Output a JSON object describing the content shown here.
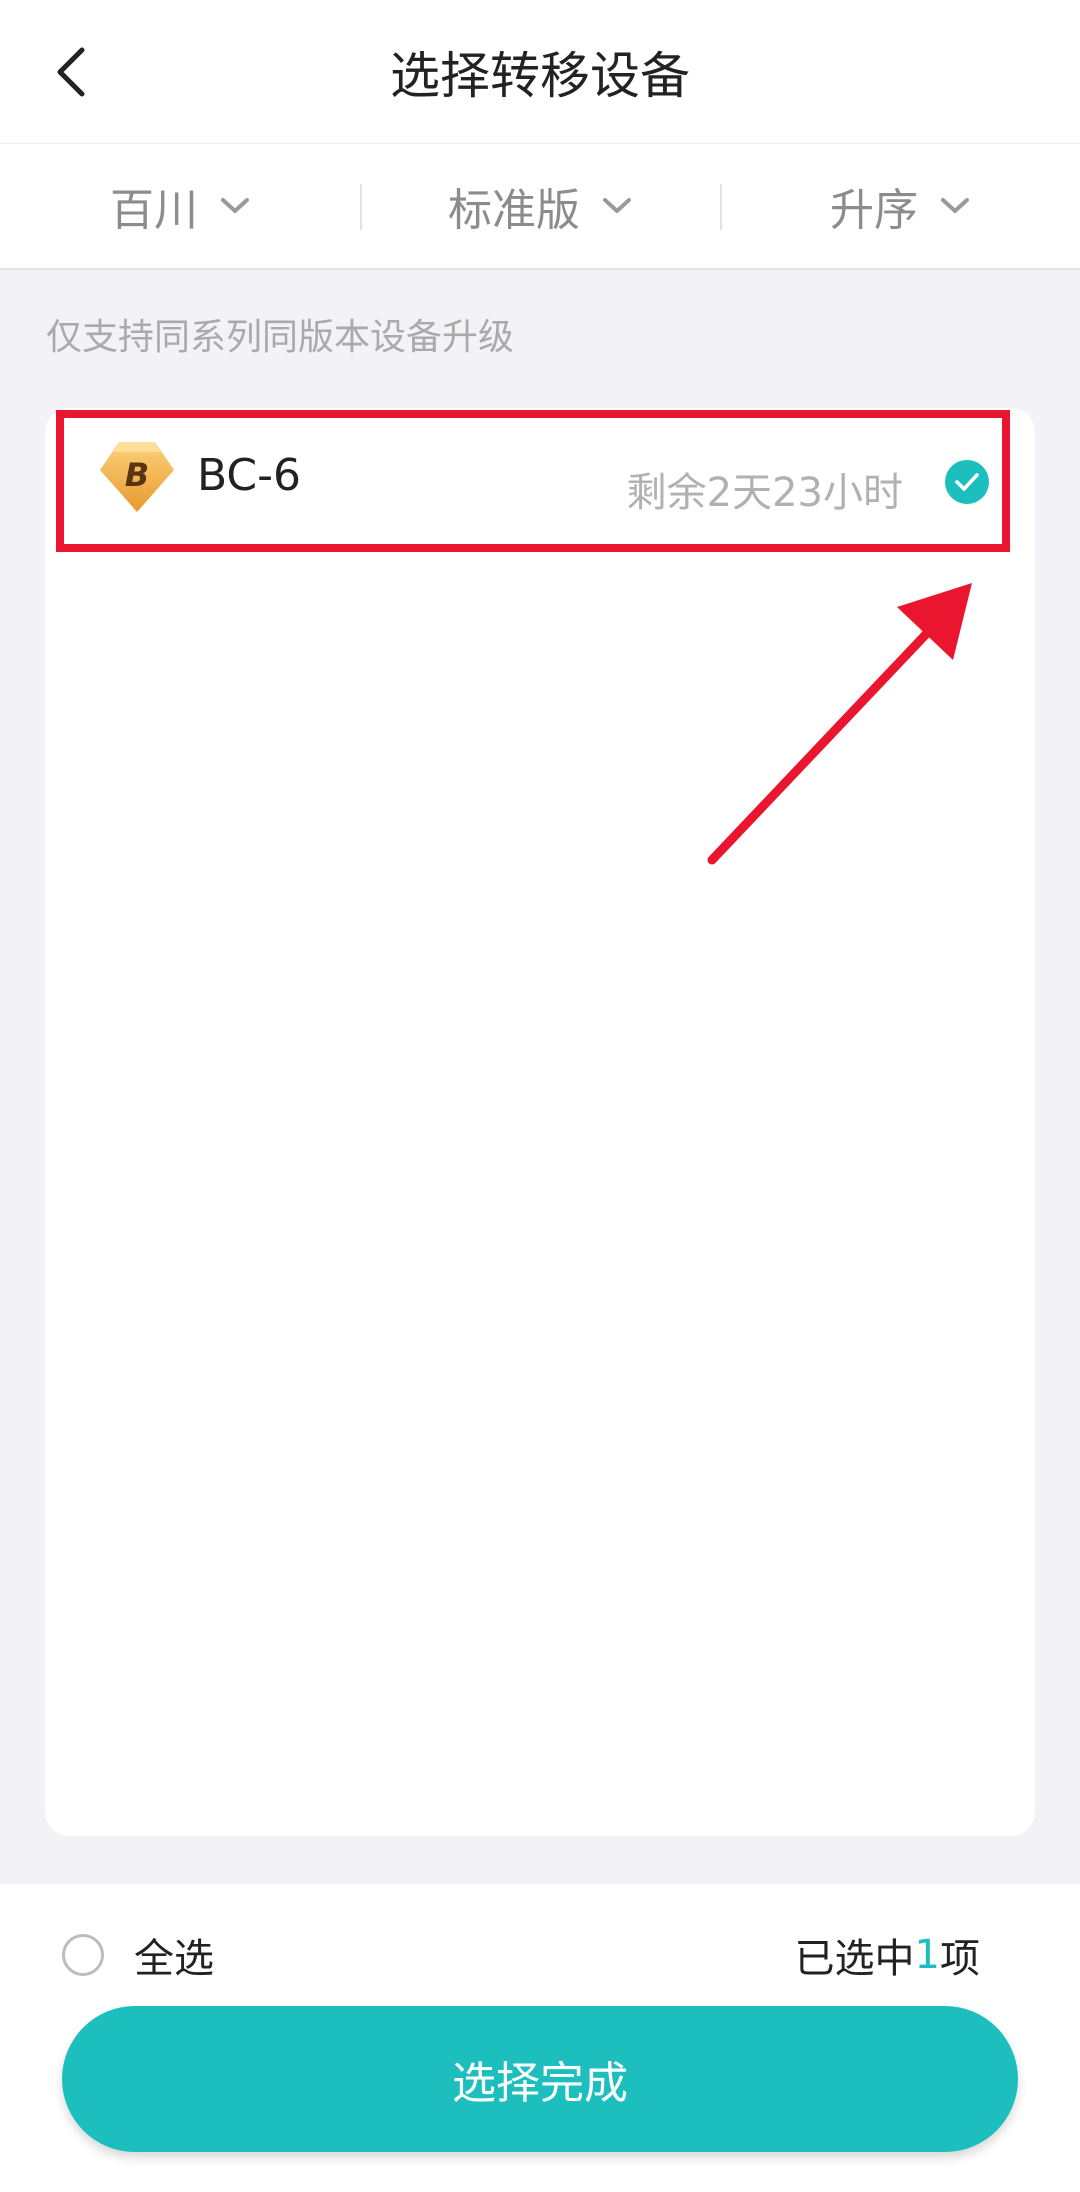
{
  "header": {
    "title": "选择转移设备"
  },
  "filters": [
    {
      "label": "百川"
    },
    {
      "label": "标准版"
    },
    {
      "label": "升序"
    }
  ],
  "hint": "仅支持同系列同版本设备升级",
  "devices": [
    {
      "name": "BC-6",
      "icon_letter": "B",
      "remaining": "剩余2天23小时",
      "checked": true
    }
  ],
  "footer": {
    "select_all_label": "全选",
    "selected_prefix": "已选中",
    "selected_count": "1",
    "selected_suffix": "项",
    "done_label": "选择完成"
  },
  "colors": {
    "accent": "#1cbfbd",
    "highlight": "#ea1630",
    "icon_gold": "#f0b24a"
  },
  "icons": [
    "back-arrow-icon",
    "chevron-down-icon",
    "diamond-badge-icon",
    "check-circle-icon",
    "radio-icon",
    "pointer-arrow-icon"
  ]
}
